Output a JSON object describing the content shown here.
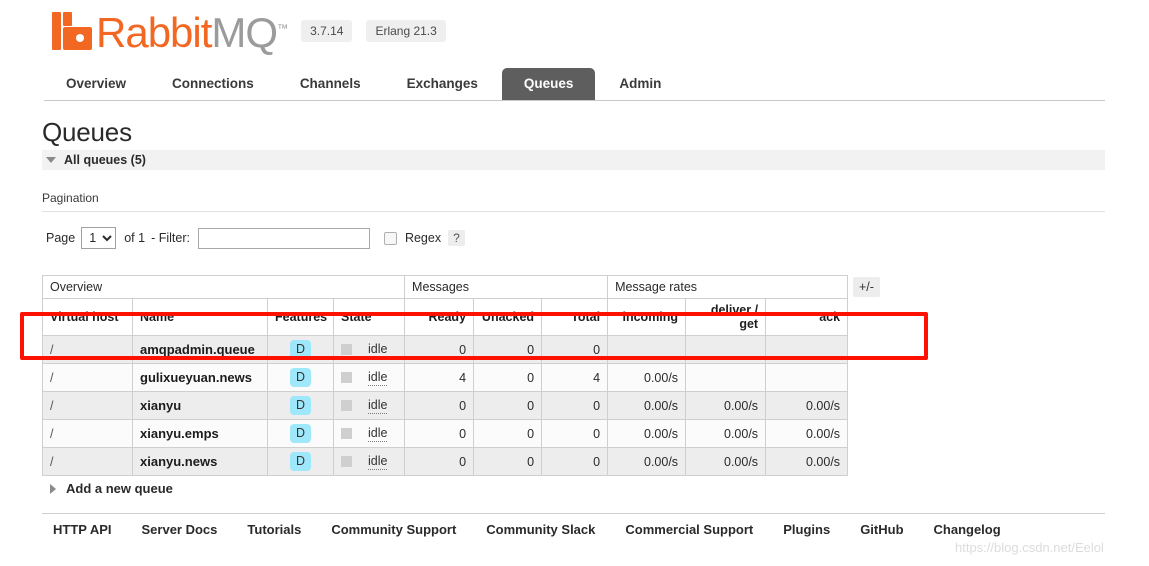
{
  "header": {
    "logo_text_primary": "Rabbit",
    "logo_text_secondary": "MQ",
    "logo_trademark": "™",
    "version_badge": "3.7.14",
    "erlang_badge": "Erlang 21.3"
  },
  "nav": {
    "tabs": [
      {
        "label": "Overview",
        "active": false
      },
      {
        "label": "Connections",
        "active": false
      },
      {
        "label": "Channels",
        "active": false
      },
      {
        "label": "Exchanges",
        "active": false
      },
      {
        "label": "Queues",
        "active": true
      },
      {
        "label": "Admin",
        "active": false
      }
    ]
  },
  "main": {
    "page_title": "Queues",
    "all_queues_label": "All queues (5)",
    "pagination_label": "Pagination",
    "pagination": {
      "page_word": "Page",
      "page_value": "1",
      "page_options": [
        "1"
      ],
      "of_text": "of 1",
      "filter_label": "- Filter:",
      "filter_value": "",
      "regex_label": "Regex",
      "regex_checked": false,
      "help_label": "?"
    },
    "table": {
      "group_headers": [
        {
          "label": "Overview",
          "span": 4
        },
        {
          "label": "Messages",
          "span": 3
        },
        {
          "label": "Message rates",
          "span": 3
        }
      ],
      "columns": [
        "Virtual host",
        "Name",
        "Features",
        "State",
        "Ready",
        "Unacked",
        "Total",
        "incoming",
        "deliver / get",
        "ack"
      ],
      "rows": [
        {
          "vhost": "/",
          "name": "amqpadmin.queue",
          "features": "D",
          "state": "idle",
          "ready": "0",
          "unacked": "0",
          "total": "0",
          "incoming": "",
          "deliver_get": "",
          "ack": ""
        },
        {
          "vhost": "/",
          "name": "gulixueyuan.news",
          "features": "D",
          "state": "idle",
          "ready": "4",
          "unacked": "0",
          "total": "4",
          "incoming": "0.00/s",
          "deliver_get": "",
          "ack": ""
        },
        {
          "vhost": "/",
          "name": "xianyu",
          "features": "D",
          "state": "idle",
          "ready": "0",
          "unacked": "0",
          "total": "0",
          "incoming": "0.00/s",
          "deliver_get": "0.00/s",
          "ack": "0.00/s"
        },
        {
          "vhost": "/",
          "name": "xianyu.emps",
          "features": "D",
          "state": "idle",
          "ready": "0",
          "unacked": "0",
          "total": "0",
          "incoming": "0.00/s",
          "deliver_get": "0.00/s",
          "ack": "0.00/s"
        },
        {
          "vhost": "/",
          "name": "xianyu.news",
          "features": "D",
          "state": "idle",
          "ready": "0",
          "unacked": "0",
          "total": "0",
          "incoming": "0.00/s",
          "deliver_get": "0.00/s",
          "ack": "0.00/s"
        }
      ],
      "column_toggle_label": "+/-"
    },
    "add_queue_label": "Add a new queue"
  },
  "footer": {
    "links": [
      "HTTP API",
      "Server Docs",
      "Tutorials",
      "Community Support",
      "Community Slack",
      "Commercial Support",
      "Plugins",
      "GitHub",
      "Changelog"
    ]
  },
  "watermark": "https://blog.csdn.net/Eelol",
  "colors": {
    "brand_orange": "#f26722",
    "active_tab": "#5e5e5e",
    "feature_badge": "#9fe8fb",
    "annotation_red": "#fe1100"
  }
}
